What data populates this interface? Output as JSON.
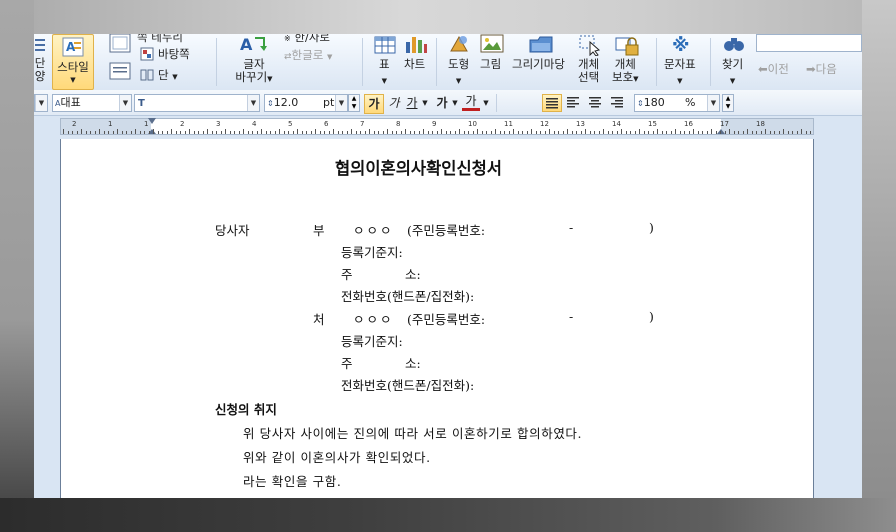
{
  "ribbon": {
    "paragraph_label_line1": "단",
    "paragraph_label_line2": "양",
    "style_label": "스타일",
    "border_label": "쪽 테두리",
    "background_label": "바탕쪽",
    "columns_label": "단",
    "replace_label": "글자\n바꾸기",
    "replace_line1": "글자",
    "replace_line2": "바꾸기",
    "cross_ref_label": "한/자로",
    "hangul_label": "한글로",
    "table_label": "표",
    "chart_label": "차트",
    "shape_label": "도형",
    "picture_label": "그림",
    "clipart_label": "그리기마당",
    "select_object_line1": "개체",
    "select_object_line2": "선택",
    "protect_object_line1": "개체",
    "protect_object_line2": "보호",
    "symbol_label": "문자표",
    "find_label": "찾기",
    "prev_label": "이전",
    "next_label": "다음"
  },
  "format_bar": {
    "style_value": "대표",
    "font_value": "",
    "size_value": "12.0",
    "size_unit": "pt",
    "bold_label": "가",
    "italic_label": "가",
    "underline_label": "가",
    "strike_label": "가",
    "color_label": "가",
    "line_spacing_value": "180",
    "line_spacing_unit": "%"
  },
  "ruler": {
    "numbers": [
      "2",
      "1",
      "1",
      "2",
      "3",
      "4",
      "5",
      "6",
      "7",
      "8",
      "9",
      "10",
      "11",
      "12",
      "13",
      "14",
      "15",
      "16",
      "17",
      "18"
    ]
  },
  "document": {
    "title": "협의이혼의사확인신청서",
    "party_label": "당사자",
    "husband_label": "부",
    "husband_name": "ㅇㅇㅇ",
    "husband_id": "(주민등록번호:",
    "husband_id_dash": "-",
    "husband_id_close": ")",
    "husband_reg_label": "등록기준지:",
    "husband_addr_label1": "주",
    "husband_addr_label2": "소:",
    "husband_phone_label": "전화번호(핸드폰/집전화):",
    "wife_label": "처",
    "wife_name": "ㅇㅇㅇ",
    "wife_id": "(주민등록번호:",
    "wife_id_dash": "-",
    "wife_id_close": ")",
    "wife_reg_label": "등록기준지:",
    "wife_addr_label1": "주",
    "wife_addr_label2": "소:",
    "wife_phone_label": "전화번호(핸드폰/집전화):",
    "purpose_heading": "신청의 취지",
    "purpose_line1": "위 당사자 사이에는 진의에 따라 서로 이혼하기로 합의하였다.",
    "purpose_line2": "위와 같이 이혼의사가 확인되었다.",
    "purpose_line3": "라는 확인을 구함."
  }
}
